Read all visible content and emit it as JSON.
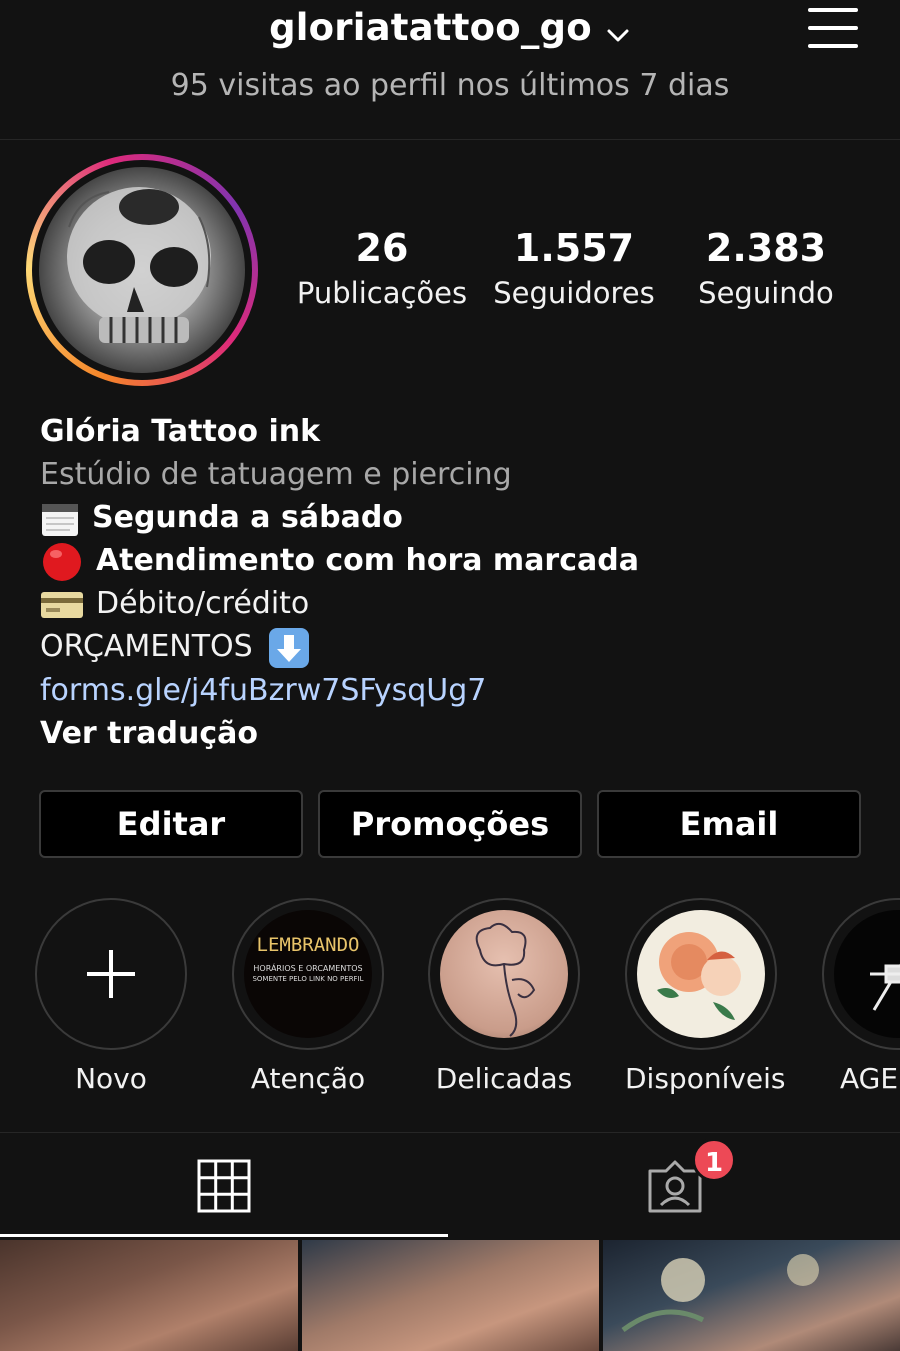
{
  "header": {
    "username": "gloriatattoo_go",
    "visits_text": "95 visitas ao perfil nos últimos 7 dias"
  },
  "profile": {
    "stats": [
      {
        "value": "26",
        "label": "Publicações"
      },
      {
        "value": "1.557",
        "label": "Seguidores"
      },
      {
        "value": "2.383",
        "label": "Seguindo"
      }
    ]
  },
  "bio": {
    "name": "Glória Tattoo ink",
    "category": "Estúdio de tatuagem e piercing",
    "line_schedule": "Segunda a sábado",
    "line_appointment": "Atendimento com hora marcada",
    "line_payment": "Débito/crédito",
    "line_quotes": "ORÇAMENTOS",
    "link": "forms.gle/j4fuBzrw7SFysqUg7",
    "translate": "Ver tradução"
  },
  "buttons": {
    "edit": "Editar",
    "promotions": "Promoções",
    "email": "Email"
  },
  "highlights": [
    {
      "label": "Novo"
    },
    {
      "label": "Atenção",
      "cover_title": "LEMBRANDO",
      "cover_sub1": "HORÁRIOS E ORCAMENTOS",
      "cover_sub2": "SOMENTE PELO LINK NO PERFIL"
    },
    {
      "label": "Delicadas"
    },
    {
      "label": "Disponíveis"
    },
    {
      "label": "AGE"
    }
  ],
  "tabs": {
    "tagged_badge": "1"
  },
  "colors": {
    "background": "#121212",
    "link": "#b8d3ff",
    "badge": "#ed4956"
  }
}
